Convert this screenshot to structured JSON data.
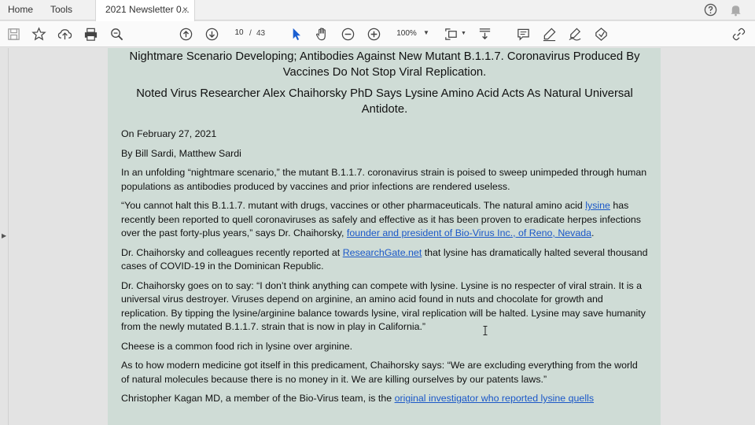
{
  "tabs": {
    "home": "Home",
    "tools": "Tools",
    "document": "2021 Newsletter 0...",
    "close": "×"
  },
  "toolbar": {
    "current_page": "10",
    "page_separator": "/",
    "total_pages": "43",
    "zoom": "100%"
  },
  "icons": [
    "save-icon",
    "bookmark-star-icon",
    "upload-icon",
    "print-icon",
    "zoom-search-icon",
    "page-up-icon",
    "page-down-icon",
    "select-cursor-icon",
    "hand-icon",
    "zoom-out-icon",
    "zoom-in-icon",
    "fit-page-icon",
    "scroll-mode-icon",
    "comment-icon",
    "highlight-pen-icon",
    "sign-icon",
    "fill-sign-icon",
    "share-link-icon",
    "help-icon",
    "bell-icon"
  ],
  "article": {
    "headline": "Nightmare Scenario Developing; Antibodies Against New Mutant B.1.1.7. Coronavirus Produced By Vaccines Do Not Stop Viral Replication.",
    "subheadline": "Noted Virus Researcher Alex Chaihorsky PhD Says Lysine Amino Acid Acts As Natural Universal Antidote.",
    "date": "On February 27, 2021",
    "byline": "By Bill Sardi, Matthew Sardi",
    "p1": "In an unfolding “nightmare scenario,” the mutant B.1.1.7. coronavirus strain is poised to sweep unimpeded through human populations as antibodies produced by vaccines and prior infections are rendered useless.",
    "p2_a": "“You cannot halt this B.1.1.7. mutant with drugs, vaccines or other pharmaceuticals. The natural amino acid ",
    "p2_link1": "lysine",
    "p2_b": " has recently been reported to quell coronaviruses as safely and effective as it has been proven to eradicate herpes infections over the past forty-plus years,” says Dr. Chaihorsky, ",
    "p2_link2": "founder and president of Bio-Virus Inc., of Reno, Nevada",
    "p2_c": ".",
    "p3_a": "Dr. Chaihorsky and colleagues recently reported at ",
    "p3_link": "ResearchGate.net",
    "p3_b": " that lysine has dramatically halted several thousand cases of COVID-19 in the Dominican Republic.",
    "p4": "Dr. Chaihorsky goes on to say: “I don’t think anything can compete with lysine. Lysine is no respecter of viral strain. It is a universal virus destroyer. Viruses depend on arginine, an amino acid found in nuts and chocolate for growth and replication.  By tipping the lysine/arginine balance towards lysine, viral replication will be halted.  Lysine may save humanity from the newly mutated B.1.1.7. strain that is now in play in California.”",
    "p5": "Cheese is a common food rich in lysine over arginine.",
    "p6": "As to how modern medicine got itself in this predicament, Chaihorsky says: “We are excluding everything from the world of natural molecules because there is no money in it. We are killing ourselves by our patents laws.”",
    "p7_a": "Christopher Kagan MD, a member of the Bio-Virus team, is the ",
    "p7_link": "original investigator who reported lysine quells"
  },
  "colors": {
    "page_background": "#cfdcd6",
    "link": "#1b58c8",
    "select_cursor": "#1a5fd1"
  }
}
